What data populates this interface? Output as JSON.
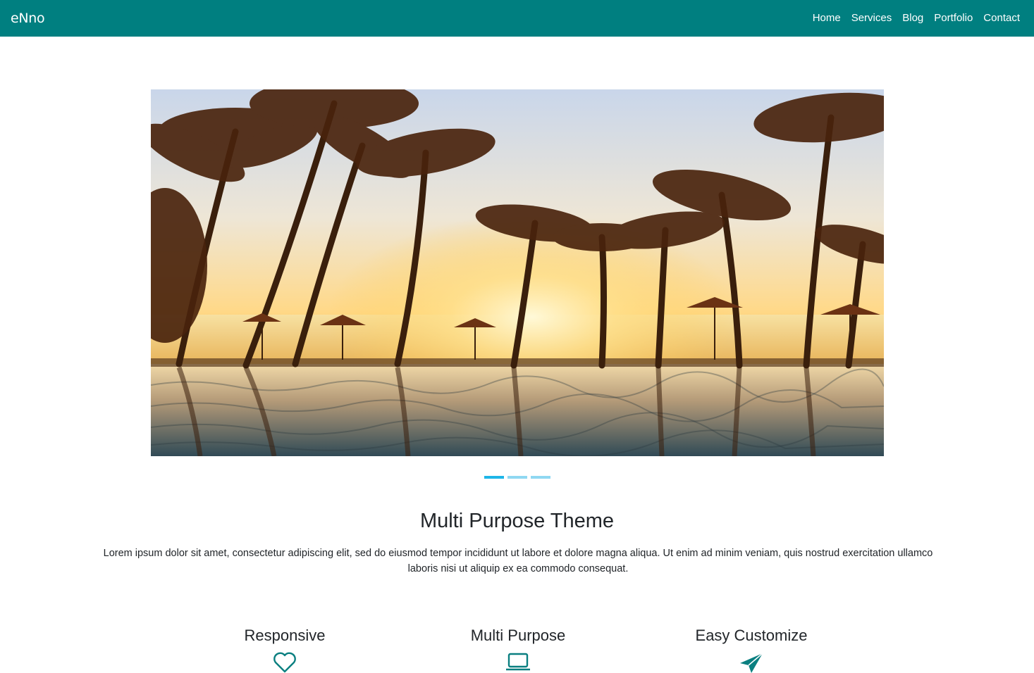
{
  "nav": {
    "brand": "eNno",
    "links": [
      "Home",
      "Services",
      "Blog",
      "Portfolio",
      "Contact"
    ]
  },
  "carousel": {
    "slide_count": 3,
    "active_index": 0
  },
  "intro": {
    "title": "Multi Purpose Theme",
    "text": "Lorem ipsum dolor sit amet, consectetur adipiscing elit, sed do eiusmod tempor incididunt ut labore et dolore magna aliqua. Ut enim ad minim veniam, quis nostrud exercitation ullamco laboris nisi ut aliquip ex ea commodo consequat."
  },
  "features": [
    {
      "title": "Responsive",
      "icon": "heart-icon"
    },
    {
      "title": "Multi Purpose",
      "icon": "laptop-icon"
    },
    {
      "title": "Easy Customize",
      "icon": "send-icon"
    }
  ],
  "colors": {
    "navbar": "#007f80",
    "accent": "#1eb6e8",
    "icon": "#0a7f80"
  }
}
